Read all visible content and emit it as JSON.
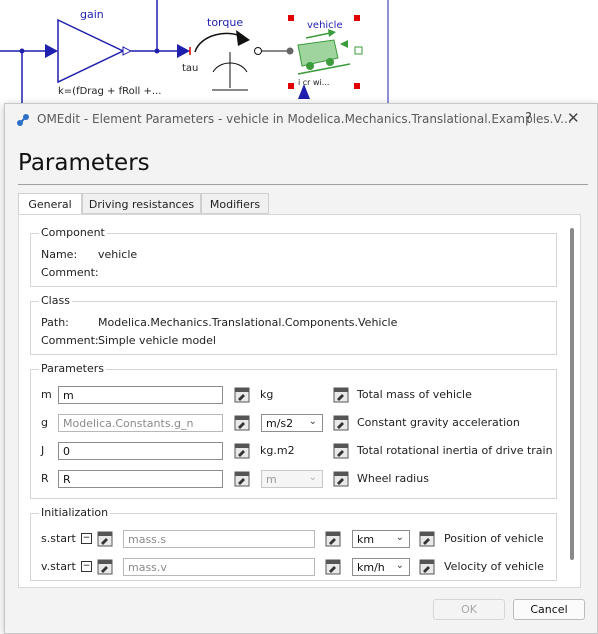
{
  "diagram": {
    "gain_label": "gain",
    "gain_param": "k=(fDrag + fRoll +...",
    "torque_label": "torque",
    "tau_label": "tau",
    "vehicle_label": "vehicle",
    "vehicle_ports": "i     cr  wi..."
  },
  "window": {
    "title": "OMEdit - Element Parameters - vehicle in Modelica.Mechanics.Translational.Examples.V...",
    "help": "?",
    "close": "✕"
  },
  "heading": "Parameters",
  "tabs": [
    {
      "label": "General",
      "active": true
    },
    {
      "label": "Driving resistances",
      "active": false
    },
    {
      "label": "Modifiers",
      "active": false
    }
  ],
  "component": {
    "title": "Component",
    "name_label": "Name:",
    "name_value": "vehicle",
    "comment_label": "Comment:",
    "comment_value": ""
  },
  "class": {
    "title": "Class",
    "path_label": "Path:",
    "path_value": "Modelica.Mechanics.Translational.Components.Vehicle",
    "comment_label": "Comment:",
    "comment_value": "Simple vehicle model"
  },
  "parameters": {
    "title": "Parameters",
    "rows": [
      {
        "name": "m",
        "value": "m",
        "unit": "kg",
        "description": "Total mass of vehicle"
      },
      {
        "name": "g",
        "value": "Modelica.Constants.g_n",
        "unit": "m/s2",
        "description": "Constant gravity acceleration"
      },
      {
        "name": "J",
        "value": "0",
        "unit": "kg.m2",
        "description": "Total rotational inertia of drive train"
      },
      {
        "name": "R",
        "value": "R",
        "unit": "m",
        "description": "Wheel radius"
      }
    ]
  },
  "initialization": {
    "title": "Initialization",
    "rows": [
      {
        "name": "s.start",
        "value": "mass.s",
        "unit": "km",
        "description": "Position of vehicle"
      },
      {
        "name": "v.start",
        "value": "mass.v",
        "unit": "km/h",
        "description": "Velocity of vehicle"
      }
    ]
  },
  "buttons": {
    "ok": "OK",
    "cancel": "Cancel"
  },
  "colors": {
    "wire": "#1f1fae",
    "selection": "#e00000",
    "vehicle": "#3b9a3b"
  }
}
